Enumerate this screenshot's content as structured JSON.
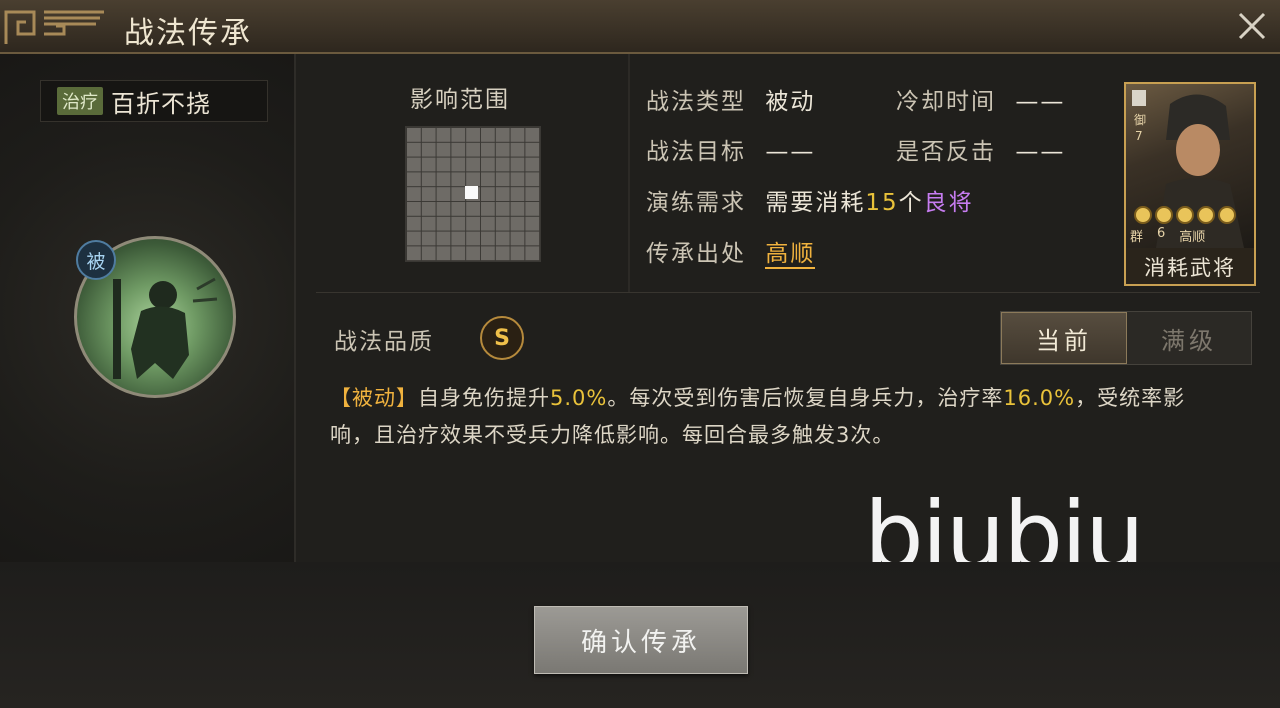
{
  "window": {
    "title": "战法传承",
    "close_icon": "close-icon"
  },
  "skill": {
    "type_tag": "治疗",
    "name": "百折不挠",
    "passive_badge": "被"
  },
  "range": {
    "label": "影响范围"
  },
  "info": {
    "type_label": "战法类型",
    "type_value": "被动",
    "cooldown_label": "冷却时间",
    "cooldown_value": "——",
    "target_label": "战法目标",
    "target_value": "——",
    "counter_label": "是否反击",
    "counter_value": "——",
    "req_label": "演练需求",
    "req_prefix": "需要消耗",
    "req_count": "15",
    "req_unit": "个",
    "req_item": "良将",
    "origin_label": "传承出处",
    "origin_value": "高顺"
  },
  "card": {
    "label": "消耗武将",
    "side_text": "御",
    "cost": "7",
    "faction": "群",
    "level": "6",
    "name": "高顺",
    "stars": 5
  },
  "quality": {
    "label": "战法品质",
    "grade": "S"
  },
  "toggle": {
    "current": "当前",
    "max": "满级"
  },
  "description": {
    "tag": "【被动】",
    "p1": "自身免伤提升",
    "v1": "5.0%",
    "p2": "。每次受到伤害后恢复自身兵力，治疗率",
    "v2": "16.0%",
    "p3": "，受统率影响，且治疗效果不受兵力降低影响。每回合最多触发3次。"
  },
  "watermark": "biubiu",
  "confirm_button": "确认传承",
  "colors": {
    "accent": "#f0b23e",
    "purple": "#c67cf0",
    "heal_tag": "#5a6b3a"
  }
}
